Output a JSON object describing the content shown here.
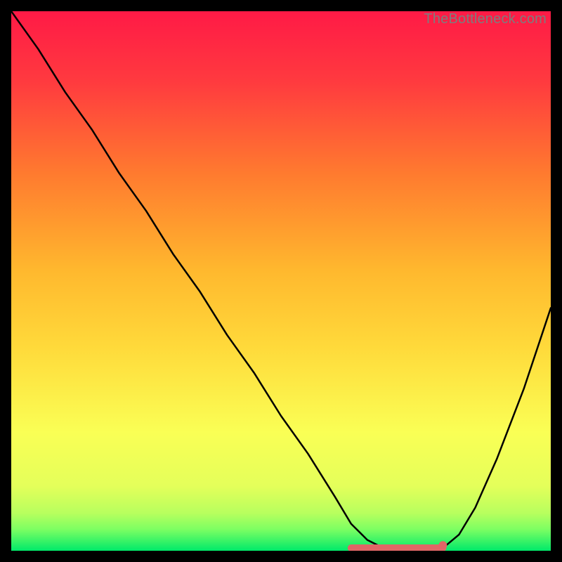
{
  "attribution": "TheBottleneck.com",
  "colors": {
    "gradient_top": "#ff1a46",
    "gradient_mid": "#ffd335",
    "gradient_low": "#f7ff57",
    "gradient_bottom": "#00e96a",
    "curve": "#000000",
    "marker": "#e06666",
    "frame": "#000000"
  },
  "chart_data": {
    "type": "line",
    "title": "",
    "xlabel": "",
    "ylabel": "",
    "xlim": [
      0,
      100
    ],
    "ylim": [
      0,
      100
    ],
    "grid": false,
    "legend": false,
    "series": [
      {
        "name": "bottleneck-curve",
        "x": [
          0,
          5,
          10,
          15,
          20,
          25,
          30,
          35,
          40,
          45,
          50,
          55,
          60,
          63,
          66,
          69,
          72,
          75,
          78,
          80,
          83,
          86,
          90,
          95,
          100
        ],
        "y": [
          100,
          93,
          85,
          78,
          70,
          63,
          55,
          48,
          40,
          33,
          25,
          18,
          10,
          5,
          2,
          0.5,
          0,
          0,
          0,
          0.5,
          3,
          8,
          17,
          30,
          45
        ]
      }
    ],
    "annotations": [
      {
        "name": "flat-segment",
        "x_range": [
          63,
          80
        ],
        "y": 0,
        "style": "thick-pink"
      },
      {
        "name": "marker-dot",
        "x": 80,
        "y": 0.5,
        "style": "dot-pink"
      }
    ]
  }
}
